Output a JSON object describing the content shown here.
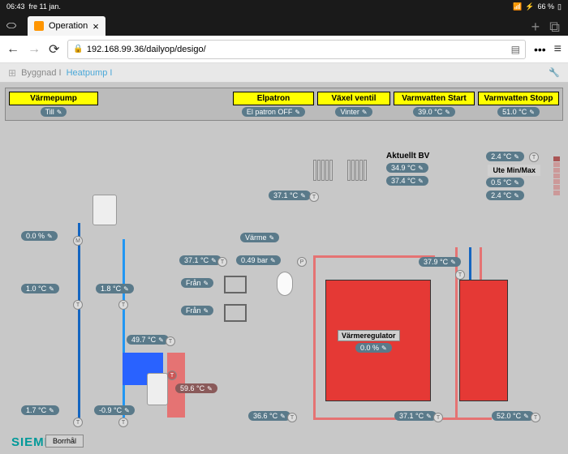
{
  "status": {
    "time": "06:43",
    "date": "fre 11 jan.",
    "battery": "66 %",
    "wifi": "▾"
  },
  "tab": {
    "title": "Operation"
  },
  "url": "192.168.99.36/dailyop/desigo/",
  "breadcrumb": {
    "root": "Byggnad I",
    "current": "Heatpump I"
  },
  "controls": [
    {
      "id": "varmepump",
      "header": "Värmepump",
      "value": "Till"
    },
    {
      "id": "elpatron",
      "header": "Elpatron",
      "value": "El patron OFF"
    },
    {
      "id": "vaxelventil",
      "header": "Växel ventil",
      "value": "Vinter"
    },
    {
      "id": "vv-start",
      "header": "Varmvatten Start",
      "value": "39.0 °C"
    },
    {
      "id": "vv-stopp",
      "header": "Varmvatten Stopp",
      "value": "51.0 °C"
    }
  ],
  "diagram": {
    "aktuellt_bv": "Aktuellt BV",
    "aktuellt_bv_val": "34.9 °C",
    "bv2": "37.4 °C",
    "ute_minmax": "Ute Min/Max",
    "ute1": "2.4 °C",
    "ute2": "0.5 °C",
    "ute3": "2.4 °C",
    "t_rad": "37.1 °C",
    "varme": "Värme",
    "t_371": "37.1 °C",
    "p_bar": "0.49 bar",
    "fran1": "Från",
    "fran2": "Från",
    "t_tank_top": "37.9 °C",
    "regulator": "Värmeregulator",
    "reg_val": "0.0 %",
    "pct_pump": "0.0 %",
    "t_10": "1.0 °C",
    "t_18": "1.8 °C",
    "t_497": "49.7 °C",
    "t_596": "59.6 °C",
    "t_17": "1.7 °C",
    "t_n09": "-0.9 °C",
    "t_366": "36.6 °C",
    "t_371b": "37.1 °C",
    "t_520": "52.0 °C",
    "brand": "SIEMENS",
    "borrhal": "Borrhål"
  }
}
